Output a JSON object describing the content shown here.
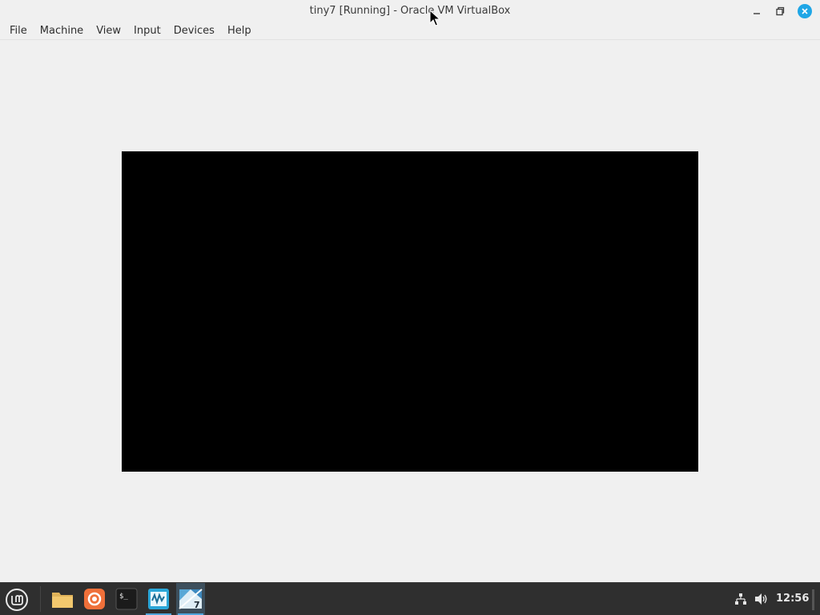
{
  "window": {
    "title": "tiny7 [Running] - Oracle VM VirtualBox"
  },
  "menu": {
    "items": [
      "File",
      "Machine",
      "View",
      "Input",
      "Devices",
      "Help"
    ]
  },
  "taskbar": {
    "clock": "12:56",
    "launchers": [
      "folder-icon",
      "firefox-icon",
      "terminal-icon",
      "virtualbox-manager-icon",
      "virtualbox-vm-icon"
    ]
  },
  "colors": {
    "accent": "#1fa6e6",
    "taskbar_bg": "#2f2f2f",
    "vm_screen": "#000000",
    "window_bg": "#f0f0f0"
  }
}
